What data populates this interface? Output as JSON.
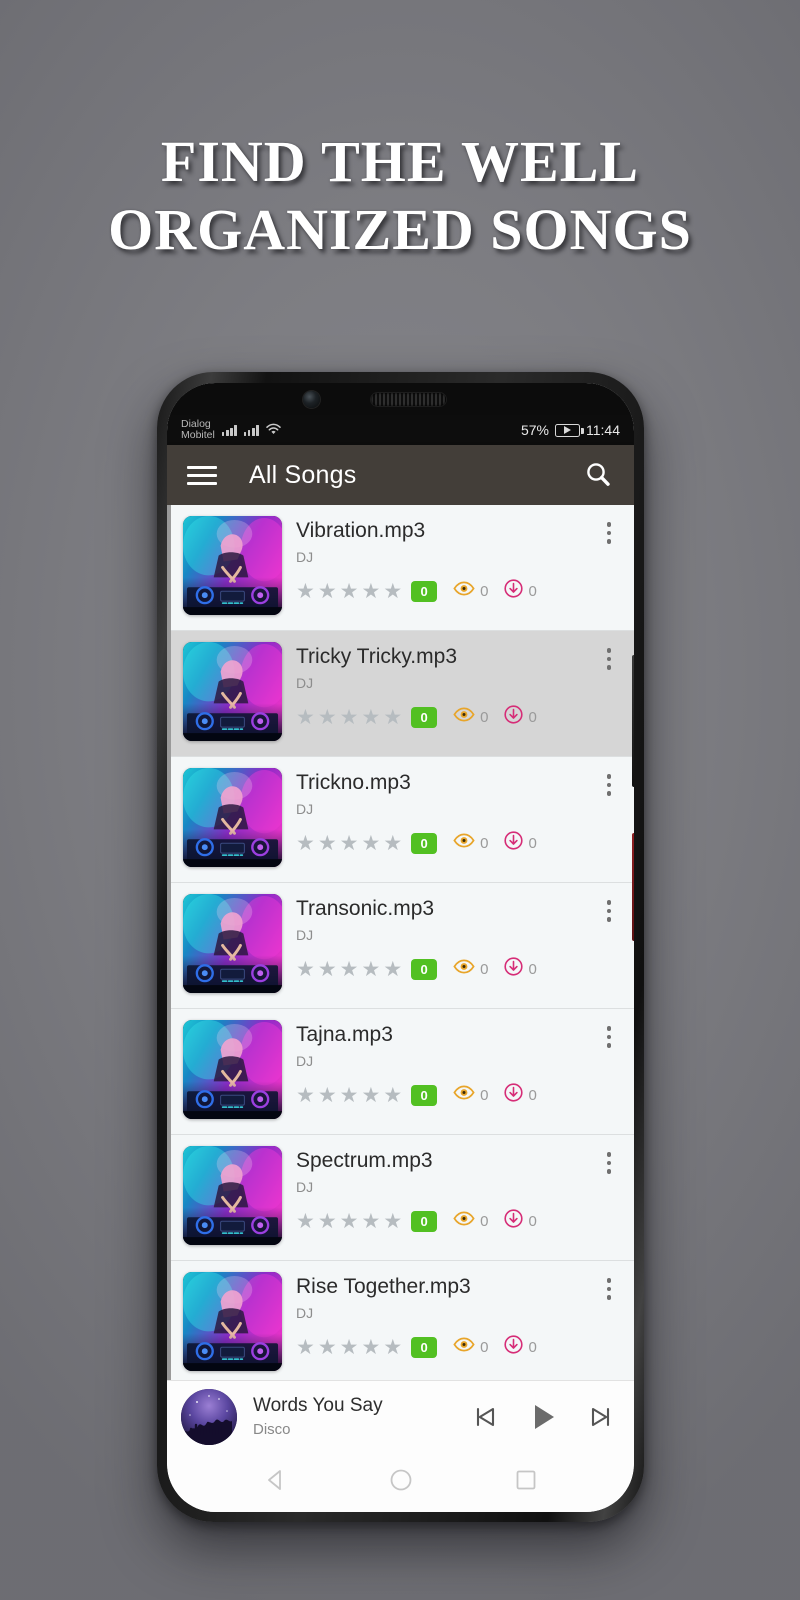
{
  "headline": "FIND THE WELL\nORGANIZED SONGS",
  "status_bar": {
    "carrier_line1": "Dialog",
    "carrier_line2": "Mobitel",
    "battery_percent": "57%",
    "clock": "11:44",
    "signal_icon": "signal-bars-icon",
    "wifi_icon": "wifi-icon",
    "battery_icon": "battery-charging-icon"
  },
  "app_bar": {
    "menu_icon": "hamburger-menu-icon",
    "title": "All Songs",
    "search_icon": "search-icon"
  },
  "songs": [
    {
      "title": "Vibration.mp3",
      "artist": "DJ",
      "rating": 0,
      "rating_badge": "0",
      "views": "0",
      "downloads": "0",
      "selected": false
    },
    {
      "title": "Tricky Tricky.mp3",
      "artist": "DJ",
      "rating": 0,
      "rating_badge": "0",
      "views": "0",
      "downloads": "0",
      "selected": true
    },
    {
      "title": "Trickno.mp3",
      "artist": "DJ",
      "rating": 0,
      "rating_badge": "0",
      "views": "0",
      "downloads": "0",
      "selected": false
    },
    {
      "title": "Transonic.mp3",
      "artist": "DJ",
      "rating": 0,
      "rating_badge": "0",
      "views": "0",
      "downloads": "0",
      "selected": false
    },
    {
      "title": "Tajna.mp3",
      "artist": "DJ",
      "rating": 0,
      "rating_badge": "0",
      "views": "0",
      "downloads": "0",
      "selected": false
    },
    {
      "title": "Spectrum.mp3",
      "artist": "DJ",
      "rating": 0,
      "rating_badge": "0",
      "views": "0",
      "downloads": "0",
      "selected": false
    },
    {
      "title": "Rise Together.mp3",
      "artist": "DJ",
      "rating": 0,
      "rating_badge": "0",
      "views": "0",
      "downloads": "0",
      "selected": false
    }
  ],
  "star_glyph": "★",
  "mini_player": {
    "title": "Words You Say",
    "subtitle": "Disco",
    "previous_icon": "skip-previous-icon",
    "play_icon": "play-icon",
    "next_icon": "skip-next-icon"
  },
  "nav_bar": {
    "back_icon": "back-triangle-icon",
    "home_icon": "home-circle-icon",
    "recents_icon": "recents-square-icon"
  },
  "colors": {
    "background": "#7d7d82",
    "app_bar": "#433e39",
    "badge_green": "#52c022",
    "eye_orange": "#e8a52a",
    "download_pink": "#d62d77",
    "star_gray": "#b6bcc0",
    "row_background": "#f4f7f8",
    "row_selected": "#d6d6d6"
  }
}
